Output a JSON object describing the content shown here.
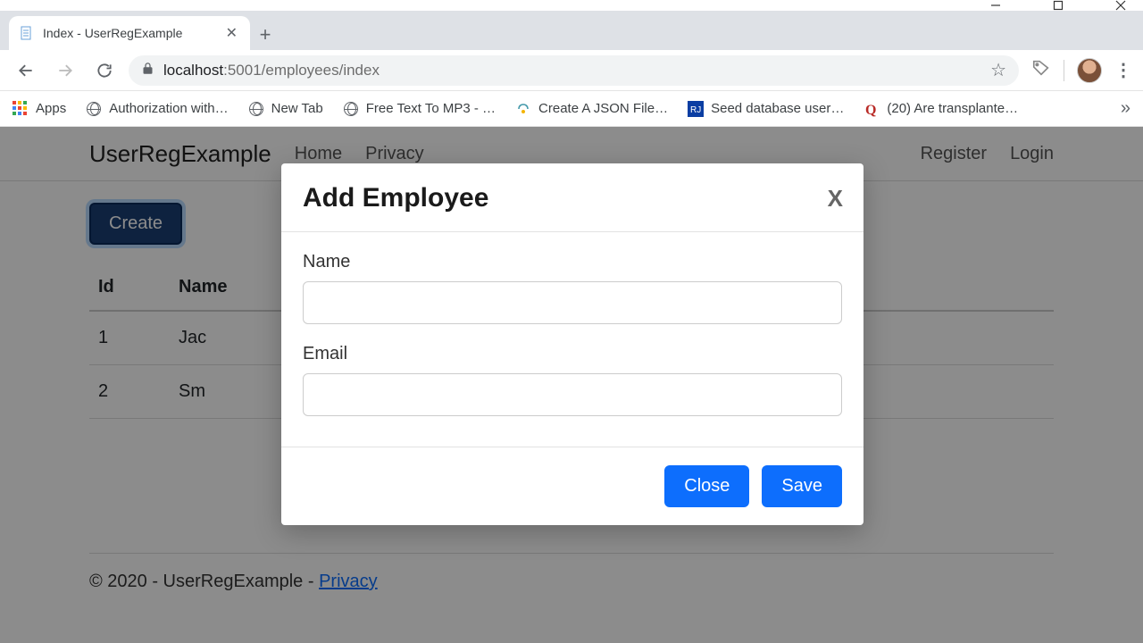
{
  "window": {
    "tab_title": "Index - UserRegExample",
    "url_host": "localhost",
    "url_port": ":5001",
    "url_path": "/employees/index"
  },
  "bookmarks": {
    "apps": "Apps",
    "items": [
      "Authorization with…",
      "New Tab",
      "Free Text To MP3 - …",
      "Create A JSON File…",
      "Seed database user…",
      "(20) Are transplante…"
    ]
  },
  "nav": {
    "brand": "UserRegExample",
    "home": "Home",
    "privacy": "Privacy",
    "register": "Register",
    "login": "Login"
  },
  "page": {
    "create_btn": "Create",
    "table": {
      "headers": {
        "id": "Id",
        "name": "Name"
      },
      "rows": [
        {
          "id": "1",
          "name": "Jac"
        },
        {
          "id": "2",
          "name": "Sm"
        }
      ]
    },
    "footer_text": "© 2020 - UserRegExample - ",
    "footer_link": "Privacy"
  },
  "modal": {
    "title": "Add Employee",
    "close_x": "X",
    "name_label": "Name",
    "email_label": "Email",
    "close_btn": "Close",
    "save_btn": "Save"
  }
}
